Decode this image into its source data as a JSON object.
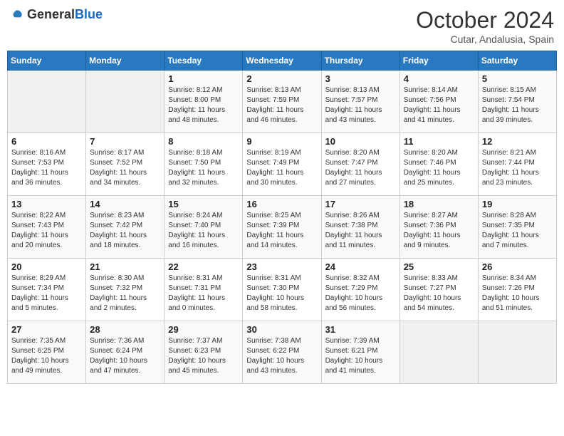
{
  "logo": {
    "text_general": "General",
    "text_blue": "Blue"
  },
  "header": {
    "month": "October 2024",
    "location": "Cutar, Andalusia, Spain"
  },
  "days_of_week": [
    "Sunday",
    "Monday",
    "Tuesday",
    "Wednesday",
    "Thursday",
    "Friday",
    "Saturday"
  ],
  "weeks": [
    [
      {
        "day": "",
        "empty": true
      },
      {
        "day": "",
        "empty": true
      },
      {
        "day": "1",
        "sunrise": "8:12 AM",
        "sunset": "8:00 PM",
        "daylight": "11 hours and 48 minutes."
      },
      {
        "day": "2",
        "sunrise": "8:13 AM",
        "sunset": "7:59 PM",
        "daylight": "11 hours and 46 minutes."
      },
      {
        "day": "3",
        "sunrise": "8:13 AM",
        "sunset": "7:57 PM",
        "daylight": "11 hours and 43 minutes."
      },
      {
        "day": "4",
        "sunrise": "8:14 AM",
        "sunset": "7:56 PM",
        "daylight": "11 hours and 41 minutes."
      },
      {
        "day": "5",
        "sunrise": "8:15 AM",
        "sunset": "7:54 PM",
        "daylight": "11 hours and 39 minutes."
      }
    ],
    [
      {
        "day": "6",
        "sunrise": "8:16 AM",
        "sunset": "7:53 PM",
        "daylight": "11 hours and 36 minutes."
      },
      {
        "day": "7",
        "sunrise": "8:17 AM",
        "sunset": "7:52 PM",
        "daylight": "11 hours and 34 minutes."
      },
      {
        "day": "8",
        "sunrise": "8:18 AM",
        "sunset": "7:50 PM",
        "daylight": "11 hours and 32 minutes."
      },
      {
        "day": "9",
        "sunrise": "8:19 AM",
        "sunset": "7:49 PM",
        "daylight": "11 hours and 30 minutes."
      },
      {
        "day": "10",
        "sunrise": "8:20 AM",
        "sunset": "7:47 PM",
        "daylight": "11 hours and 27 minutes."
      },
      {
        "day": "11",
        "sunrise": "8:20 AM",
        "sunset": "7:46 PM",
        "daylight": "11 hours and 25 minutes."
      },
      {
        "day": "12",
        "sunrise": "8:21 AM",
        "sunset": "7:44 PM",
        "daylight": "11 hours and 23 minutes."
      }
    ],
    [
      {
        "day": "13",
        "sunrise": "8:22 AM",
        "sunset": "7:43 PM",
        "daylight": "11 hours and 20 minutes."
      },
      {
        "day": "14",
        "sunrise": "8:23 AM",
        "sunset": "7:42 PM",
        "daylight": "11 hours and 18 minutes."
      },
      {
        "day": "15",
        "sunrise": "8:24 AM",
        "sunset": "7:40 PM",
        "daylight": "11 hours and 16 minutes."
      },
      {
        "day": "16",
        "sunrise": "8:25 AM",
        "sunset": "7:39 PM",
        "daylight": "11 hours and 14 minutes."
      },
      {
        "day": "17",
        "sunrise": "8:26 AM",
        "sunset": "7:38 PM",
        "daylight": "11 hours and 11 minutes."
      },
      {
        "day": "18",
        "sunrise": "8:27 AM",
        "sunset": "7:36 PM",
        "daylight": "11 hours and 9 minutes."
      },
      {
        "day": "19",
        "sunrise": "8:28 AM",
        "sunset": "7:35 PM",
        "daylight": "11 hours and 7 minutes."
      }
    ],
    [
      {
        "day": "20",
        "sunrise": "8:29 AM",
        "sunset": "7:34 PM",
        "daylight": "11 hours and 5 minutes."
      },
      {
        "day": "21",
        "sunrise": "8:30 AM",
        "sunset": "7:32 PM",
        "daylight": "11 hours and 2 minutes."
      },
      {
        "day": "22",
        "sunrise": "8:31 AM",
        "sunset": "7:31 PM",
        "daylight": "11 hours and 0 minutes."
      },
      {
        "day": "23",
        "sunrise": "8:31 AM",
        "sunset": "7:30 PM",
        "daylight": "10 hours and 58 minutes."
      },
      {
        "day": "24",
        "sunrise": "8:32 AM",
        "sunset": "7:29 PM",
        "daylight": "10 hours and 56 minutes."
      },
      {
        "day": "25",
        "sunrise": "8:33 AM",
        "sunset": "7:27 PM",
        "daylight": "10 hours and 54 minutes."
      },
      {
        "day": "26",
        "sunrise": "8:34 AM",
        "sunset": "7:26 PM",
        "daylight": "10 hours and 51 minutes."
      }
    ],
    [
      {
        "day": "27",
        "sunrise": "7:35 AM",
        "sunset": "6:25 PM",
        "daylight": "10 hours and 49 minutes."
      },
      {
        "day": "28",
        "sunrise": "7:36 AM",
        "sunset": "6:24 PM",
        "daylight": "10 hours and 47 minutes."
      },
      {
        "day": "29",
        "sunrise": "7:37 AM",
        "sunset": "6:23 PM",
        "daylight": "10 hours and 45 minutes."
      },
      {
        "day": "30",
        "sunrise": "7:38 AM",
        "sunset": "6:22 PM",
        "daylight": "10 hours and 43 minutes."
      },
      {
        "day": "31",
        "sunrise": "7:39 AM",
        "sunset": "6:21 PM",
        "daylight": "10 hours and 41 minutes."
      },
      {
        "day": "",
        "empty": true
      },
      {
        "day": "",
        "empty": true
      }
    ]
  ]
}
